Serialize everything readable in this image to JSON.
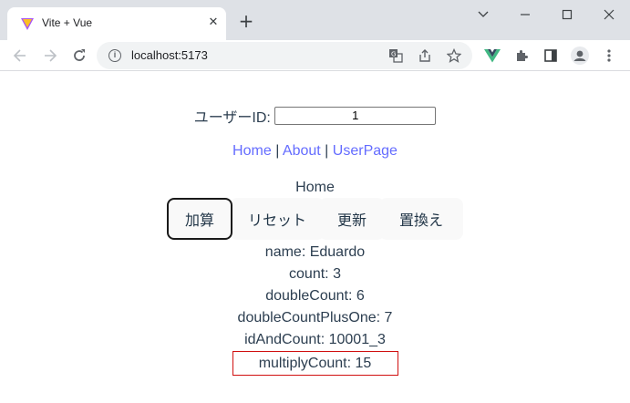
{
  "browser": {
    "tab_title": "Vite + Vue",
    "url": "localhost:5173",
    "icons": {
      "favicon": "vite-logo-icon",
      "close": "close-icon",
      "new_tab": "plus-icon",
      "minimize": "minimize-icon",
      "maximize": "maximize-icon",
      "window_close": "window-close-icon",
      "back": "back-arrow-icon",
      "forward": "forward-arrow-icon",
      "reload": "reload-icon",
      "info": "info-icon",
      "translate": "translate-icon",
      "share": "share-icon",
      "bookmark": "star-icon",
      "vue_devtools": "vue-logo-icon",
      "extensions": "puzzle-icon",
      "side_panel": "side-panel-icon",
      "profile": "profile-icon",
      "menu": "kebab-menu-icon"
    },
    "colors": {
      "titlebar": "#dee1e6",
      "vue_green": "#41b883",
      "link": "#646cff",
      "highlight_border": "#d01010"
    }
  },
  "page": {
    "user_id_label": "ユーザーID:",
    "user_id_value": "1",
    "nav": {
      "home": "Home",
      "about": "About",
      "userpage": "UserPage",
      "separator": "|"
    },
    "heading": "Home",
    "buttons": {
      "add": "加算",
      "reset": "リセット",
      "update": "更新",
      "replace": "置換え"
    },
    "stats": {
      "name": "name: Eduardo",
      "count": "count: 3",
      "double_count": "doubleCount: 6",
      "double_count_plus_one": "doubleCountPlusOne: 7",
      "id_and_count": "idAndCount: 10001_3",
      "multiply_count": "multiplyCount: 15"
    }
  }
}
